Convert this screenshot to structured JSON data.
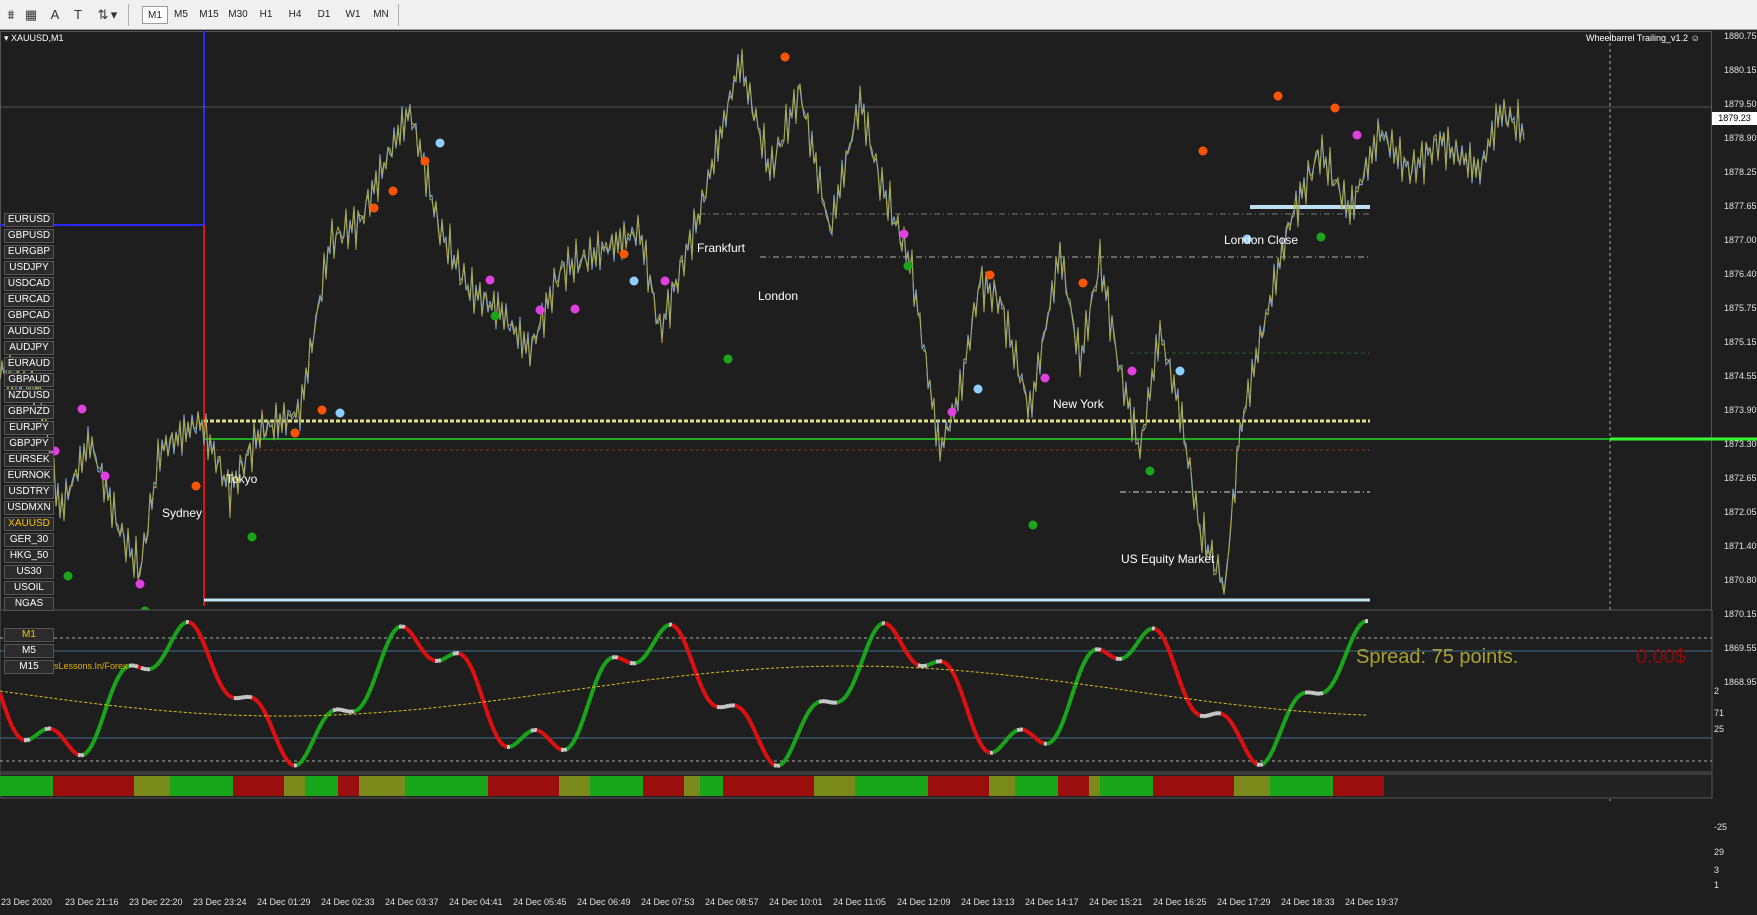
{
  "toolbar": {
    "timeframes": [
      "M1",
      "M5",
      "M15",
      "M30",
      "H1",
      "H4",
      "D1",
      "W1",
      "MN"
    ],
    "active_timeframe": "M1"
  },
  "chart": {
    "symbol_title": "XAUUSD,M1",
    "indicator_title": "Wheelbarrel Trailing_v1.2",
    "spread_text": "Spread: 75 points.",
    "profit_text": "0.00$",
    "watermark": "sLessons.In/Forex",
    "current_price": "1879.23",
    "sessions": [
      "Sydney",
      "Tokyo",
      "London",
      "Frankfurt",
      "New York",
      "US Equity Market",
      "London Close"
    ]
  },
  "symbols": [
    "EURUSD",
    "GBPUSD",
    "EURGBP",
    "USDJPY",
    "USDCAD",
    "EURCAD",
    "GBPCAD",
    "AUDUSD",
    "AUDJPY",
    "EURAUD",
    "GBPAUD",
    "NZDUSD",
    "GBPNZD",
    "EURJPY",
    "GBPJPY",
    "EURSEK",
    "EURNOK",
    "USDTRY",
    "USDMXN",
    "XAUUSD",
    "GER_30",
    "HKG_50",
    "US30",
    "USOIL",
    "NGAS"
  ],
  "selected_symbol": "XAUUSD",
  "period_buttons": [
    "M1",
    "M5",
    "M15"
  ],
  "price_axis": [
    "1880.75",
    "1880.15",
    "1879.50",
    "1878.90",
    "1878.25",
    "1877.65",
    "1877.00",
    "1876.40",
    "1875.75",
    "1875.15",
    "1874.55",
    "1873.90",
    "1873.30",
    "1872.65",
    "1872.05",
    "1871.40",
    "1870.80",
    "1870.15",
    "1869.55",
    "1868.95"
  ],
  "oscillator_axis": [
    "2",
    "71",
    "25",
    "-25",
    "29",
    "3",
    "1"
  ],
  "time_axis": [
    "23 Dec 2020",
    "23 Dec 21:16",
    "23 Dec 22:20",
    "23 Dec 23:24",
    "24 Dec 01:29",
    "24 Dec 02:33",
    "24 Dec 03:37",
    "24 Dec 04:41",
    "24 Dec 05:45",
    "24 Dec 06:49",
    "24 Dec 07:53",
    "24 Dec 08:57",
    "24 Dec 10:01",
    "24 Dec 11:05",
    "24 Dec 12:09",
    "24 Dec 13:13",
    "24 Dec 14:17",
    "24 Dec 15:21",
    "24 Dec 16:25",
    "24 Dec 17:29",
    "24 Dec 18:33",
    "24 Dec 19:37"
  ],
  "colors": {
    "bull": "#1aa61a",
    "bear": "#e01010",
    "neutral": "#c8c8c8",
    "price_line": "#7fa7d8",
    "signal_orange": "#ff5500",
    "signal_magenta": "#e040e0"
  }
}
